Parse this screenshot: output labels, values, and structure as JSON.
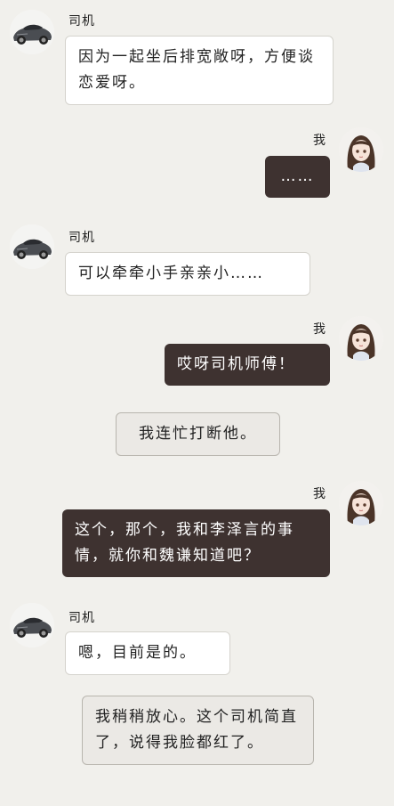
{
  "speakers": {
    "driver": "司机",
    "me": "我"
  },
  "messages": [
    {
      "text": "因为一起坐后排宽敞呀，方便谈恋爱呀。"
    },
    {
      "text": "……"
    },
    {
      "text": "可以牵牵小手亲亲小……"
    },
    {
      "text": "哎呀司机师傅！"
    },
    {
      "text": "我连忙打断他。"
    },
    {
      "text": "这个，那个，我和李泽言的事情，就你和魏谦知道吧？"
    },
    {
      "text": "嗯，目前是的。"
    },
    {
      "text": "我稍稍放心。这个司机简直了，说得我脸都红了。"
    }
  ],
  "colors": {
    "background": "#f1f0ec",
    "bubble_white": "#ffffff",
    "bubble_dark": "#3e3230",
    "bubble_narration": "#ebe9e5"
  },
  "icons": {
    "driver_avatar": "car-avatar-icon",
    "me_avatar": "girl-avatar-icon"
  }
}
